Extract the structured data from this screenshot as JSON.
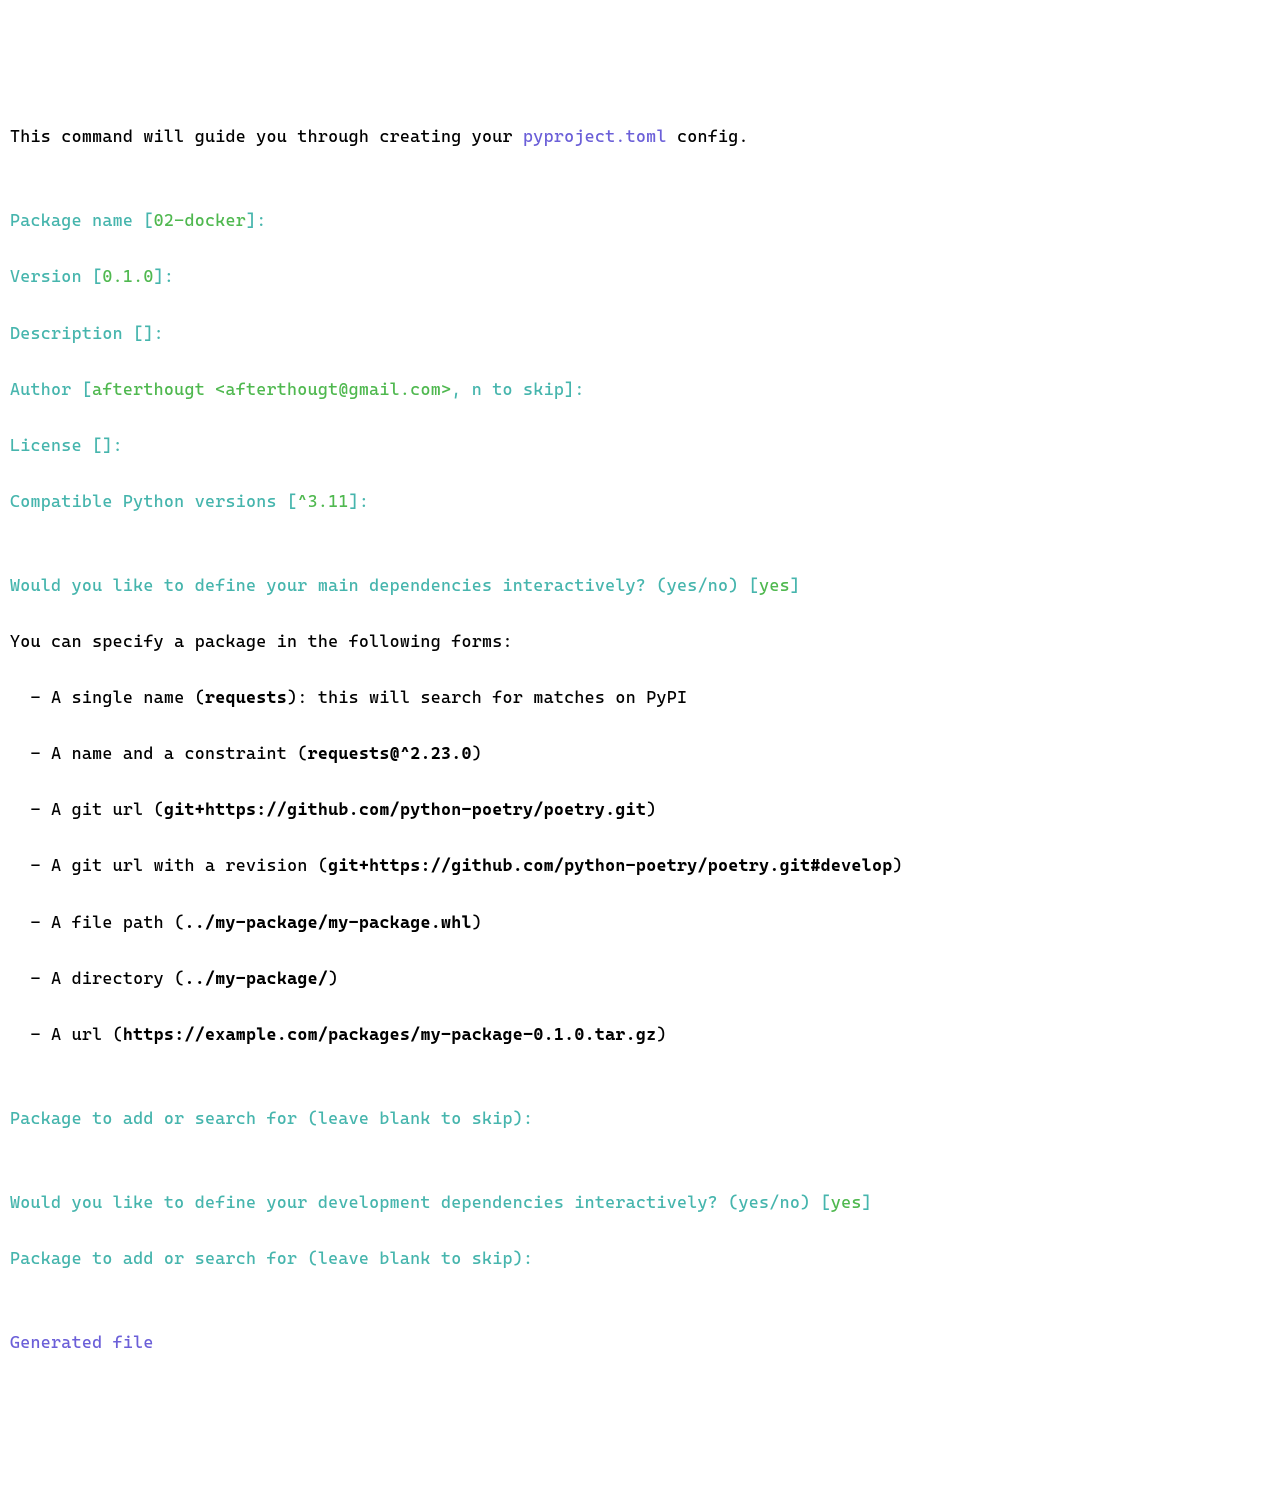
{
  "intro": {
    "prefix": "This command will guide you through creating your ",
    "filename": "pyproject.toml",
    "suffix": " config."
  },
  "prompts": {
    "package_name": {
      "label": "Package name [",
      "default": "02-docker",
      "close": "]:"
    },
    "version": {
      "label": "Version [",
      "default": "0.1.0",
      "close": "]:"
    },
    "description": {
      "label": "Description []:"
    },
    "author": {
      "label": "Author [",
      "value": "afterthougt <afterthougt@gmail.com>",
      "suffix": ", n to skip]:"
    },
    "license": {
      "label": "License []:"
    },
    "python": {
      "label": "Compatible Python versions [",
      "default": "^3.11",
      "close": "]:"
    }
  },
  "main_deps_question": {
    "text": "Would you like to define your main dependencies interactively? (yes/no) [",
    "default": "yes",
    "close": "]"
  },
  "forms_intro": "You can specify a package in the following forms:",
  "forms": [
    {
      "prefix": "A single name (",
      "code": "requests",
      "suffix": "): this will search for matches on PyPI"
    },
    {
      "prefix": "A name and a constraint (",
      "code": "requests@^2.23.0",
      "suffix": ")"
    },
    {
      "prefix": "A git url (",
      "code": "git+https://github.com/python-poetry/poetry.git",
      "suffix": ")"
    },
    {
      "prefix": "A git url with a revision (",
      "code": "git+https://github.com/python-poetry/poetry.git#develop",
      "suffix": ")"
    },
    {
      "prefix": "A file path (",
      "code": "../my-package/my-package.whl",
      "suffix": ")"
    },
    {
      "prefix": "A directory (",
      "code": "../my-package/",
      "suffix": ")"
    },
    {
      "prefix": "A url (",
      "code": "https://example.com/packages/my-package-0.1.0.tar.gz",
      "suffix": ")"
    }
  ],
  "package_add_prompt": "Package to add or search for (leave blank to skip):",
  "dev_deps_question": {
    "text": "Would you like to define your development dependencies interactively? (yes/no) [",
    "default": "yes",
    "close": "]"
  },
  "package_add_prompt2": "Package to add or search for (leave blank to skip):",
  "generated": "Generated file",
  "bullet": "  - "
}
